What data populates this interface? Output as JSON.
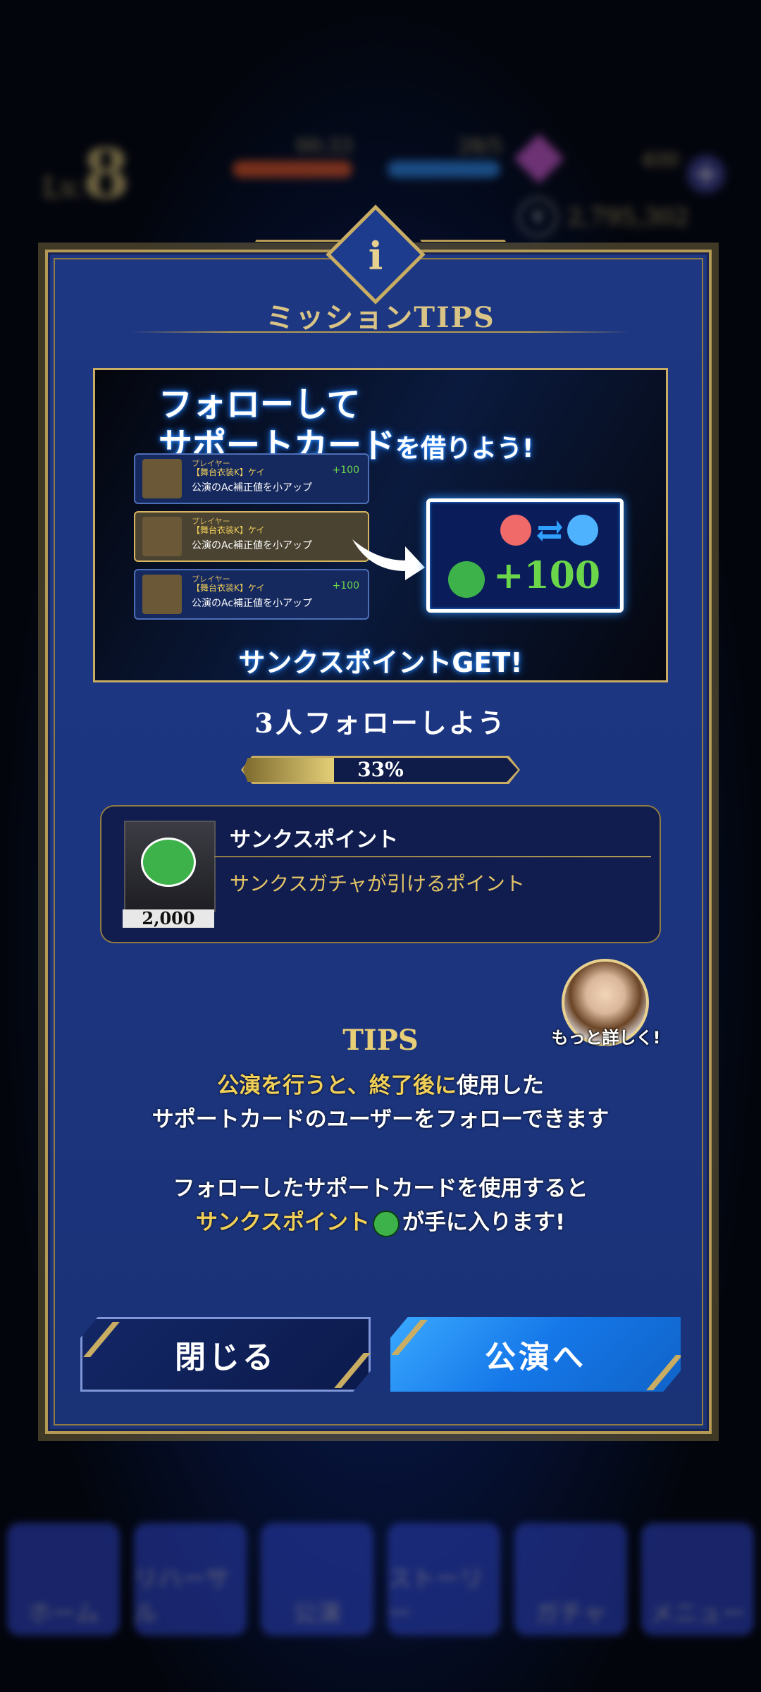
{
  "hud": {
    "level_prefix": "Lv.",
    "level": "8",
    "stamina_timer": "00:33",
    "bp": "28/5",
    "gems": "400",
    "coins": "2,795,302"
  },
  "nav": {
    "items": [
      "ホーム",
      "リハーサル",
      "公演",
      "ストーリー",
      "ガチャ",
      "メニュー"
    ]
  },
  "dialog": {
    "badge": "i",
    "title": "ミッションTIPS",
    "banner": {
      "headline_1": "フォローして",
      "headline_2a": "サポートカード",
      "headline_2b": "を借りよう!",
      "card_role": "プレイヤー",
      "card_name": "【舞台衣装K】ケイ",
      "card_desc": "公演のAc補正値を小アップ",
      "card_bonus": "+100",
      "bonus": "+100",
      "footer": "サンクスポイントGET!"
    },
    "mission": "3人フォローしよう",
    "progress": {
      "label": "33%",
      "value": 0.33
    },
    "reward": {
      "name": "サンクスポイント",
      "desc": "サンクスガチャが引けるポイント",
      "count": "2,000"
    },
    "more_label": "もっと詳しく!",
    "tips": {
      "title": "TIPS",
      "l1_gold": "公演を行うと、終了後に",
      "l1_white": "使用した",
      "l2": "サポートカードのユーザーをフォローできます",
      "l3": "フォローしたサポートカードを使用すると",
      "l4_gold": "サンクスポイント",
      "l4_white": "が手に入ります!"
    },
    "buttons": {
      "close": "閉じる",
      "go": "公演へ"
    }
  }
}
